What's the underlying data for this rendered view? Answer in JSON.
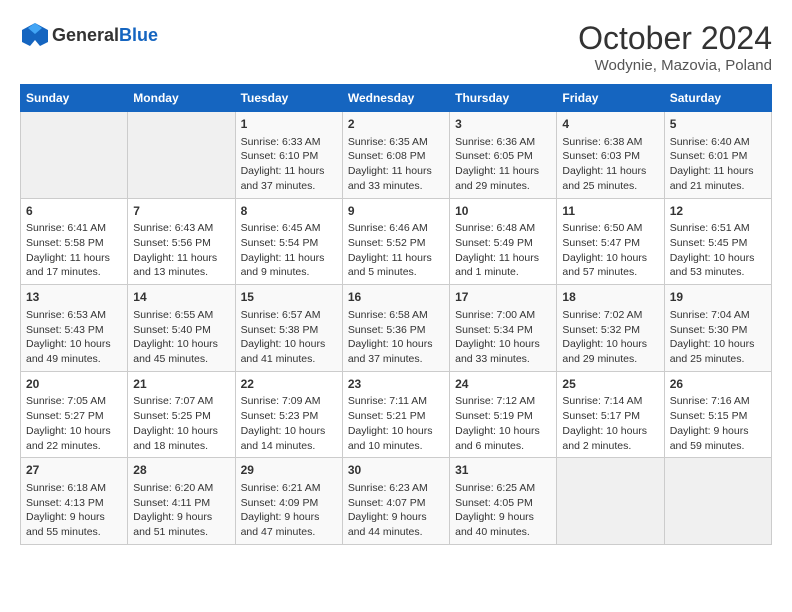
{
  "header": {
    "logo_general": "General",
    "logo_blue": "Blue",
    "month_title": "October 2024",
    "location": "Wodynie, Mazovia, Poland"
  },
  "weekdays": [
    "Sunday",
    "Monday",
    "Tuesday",
    "Wednesday",
    "Thursday",
    "Friday",
    "Saturday"
  ],
  "weeks": [
    [
      {
        "day": "",
        "info": ""
      },
      {
        "day": "",
        "info": ""
      },
      {
        "day": "1",
        "info": "Sunrise: 6:33 AM\nSunset: 6:10 PM\nDaylight: 11 hours and 37 minutes."
      },
      {
        "day": "2",
        "info": "Sunrise: 6:35 AM\nSunset: 6:08 PM\nDaylight: 11 hours and 33 minutes."
      },
      {
        "day": "3",
        "info": "Sunrise: 6:36 AM\nSunset: 6:05 PM\nDaylight: 11 hours and 29 minutes."
      },
      {
        "day": "4",
        "info": "Sunrise: 6:38 AM\nSunset: 6:03 PM\nDaylight: 11 hours and 25 minutes."
      },
      {
        "day": "5",
        "info": "Sunrise: 6:40 AM\nSunset: 6:01 PM\nDaylight: 11 hours and 21 minutes."
      }
    ],
    [
      {
        "day": "6",
        "info": "Sunrise: 6:41 AM\nSunset: 5:58 PM\nDaylight: 11 hours and 17 minutes."
      },
      {
        "day": "7",
        "info": "Sunrise: 6:43 AM\nSunset: 5:56 PM\nDaylight: 11 hours and 13 minutes."
      },
      {
        "day": "8",
        "info": "Sunrise: 6:45 AM\nSunset: 5:54 PM\nDaylight: 11 hours and 9 minutes."
      },
      {
        "day": "9",
        "info": "Sunrise: 6:46 AM\nSunset: 5:52 PM\nDaylight: 11 hours and 5 minutes."
      },
      {
        "day": "10",
        "info": "Sunrise: 6:48 AM\nSunset: 5:49 PM\nDaylight: 11 hours and 1 minute."
      },
      {
        "day": "11",
        "info": "Sunrise: 6:50 AM\nSunset: 5:47 PM\nDaylight: 10 hours and 57 minutes."
      },
      {
        "day": "12",
        "info": "Sunrise: 6:51 AM\nSunset: 5:45 PM\nDaylight: 10 hours and 53 minutes."
      }
    ],
    [
      {
        "day": "13",
        "info": "Sunrise: 6:53 AM\nSunset: 5:43 PM\nDaylight: 10 hours and 49 minutes."
      },
      {
        "day": "14",
        "info": "Sunrise: 6:55 AM\nSunset: 5:40 PM\nDaylight: 10 hours and 45 minutes."
      },
      {
        "day": "15",
        "info": "Sunrise: 6:57 AM\nSunset: 5:38 PM\nDaylight: 10 hours and 41 minutes."
      },
      {
        "day": "16",
        "info": "Sunrise: 6:58 AM\nSunset: 5:36 PM\nDaylight: 10 hours and 37 minutes."
      },
      {
        "day": "17",
        "info": "Sunrise: 7:00 AM\nSunset: 5:34 PM\nDaylight: 10 hours and 33 minutes."
      },
      {
        "day": "18",
        "info": "Sunrise: 7:02 AM\nSunset: 5:32 PM\nDaylight: 10 hours and 29 minutes."
      },
      {
        "day": "19",
        "info": "Sunrise: 7:04 AM\nSunset: 5:30 PM\nDaylight: 10 hours and 25 minutes."
      }
    ],
    [
      {
        "day": "20",
        "info": "Sunrise: 7:05 AM\nSunset: 5:27 PM\nDaylight: 10 hours and 22 minutes."
      },
      {
        "day": "21",
        "info": "Sunrise: 7:07 AM\nSunset: 5:25 PM\nDaylight: 10 hours and 18 minutes."
      },
      {
        "day": "22",
        "info": "Sunrise: 7:09 AM\nSunset: 5:23 PM\nDaylight: 10 hours and 14 minutes."
      },
      {
        "day": "23",
        "info": "Sunrise: 7:11 AM\nSunset: 5:21 PM\nDaylight: 10 hours and 10 minutes."
      },
      {
        "day": "24",
        "info": "Sunrise: 7:12 AM\nSunset: 5:19 PM\nDaylight: 10 hours and 6 minutes."
      },
      {
        "day": "25",
        "info": "Sunrise: 7:14 AM\nSunset: 5:17 PM\nDaylight: 10 hours and 2 minutes."
      },
      {
        "day": "26",
        "info": "Sunrise: 7:16 AM\nSunset: 5:15 PM\nDaylight: 9 hours and 59 minutes."
      }
    ],
    [
      {
        "day": "27",
        "info": "Sunrise: 6:18 AM\nSunset: 4:13 PM\nDaylight: 9 hours and 55 minutes."
      },
      {
        "day": "28",
        "info": "Sunrise: 6:20 AM\nSunset: 4:11 PM\nDaylight: 9 hours and 51 minutes."
      },
      {
        "day": "29",
        "info": "Sunrise: 6:21 AM\nSunset: 4:09 PM\nDaylight: 9 hours and 47 minutes."
      },
      {
        "day": "30",
        "info": "Sunrise: 6:23 AM\nSunset: 4:07 PM\nDaylight: 9 hours and 44 minutes."
      },
      {
        "day": "31",
        "info": "Sunrise: 6:25 AM\nSunset: 4:05 PM\nDaylight: 9 hours and 40 minutes."
      },
      {
        "day": "",
        "info": ""
      },
      {
        "day": "",
        "info": ""
      }
    ]
  ]
}
